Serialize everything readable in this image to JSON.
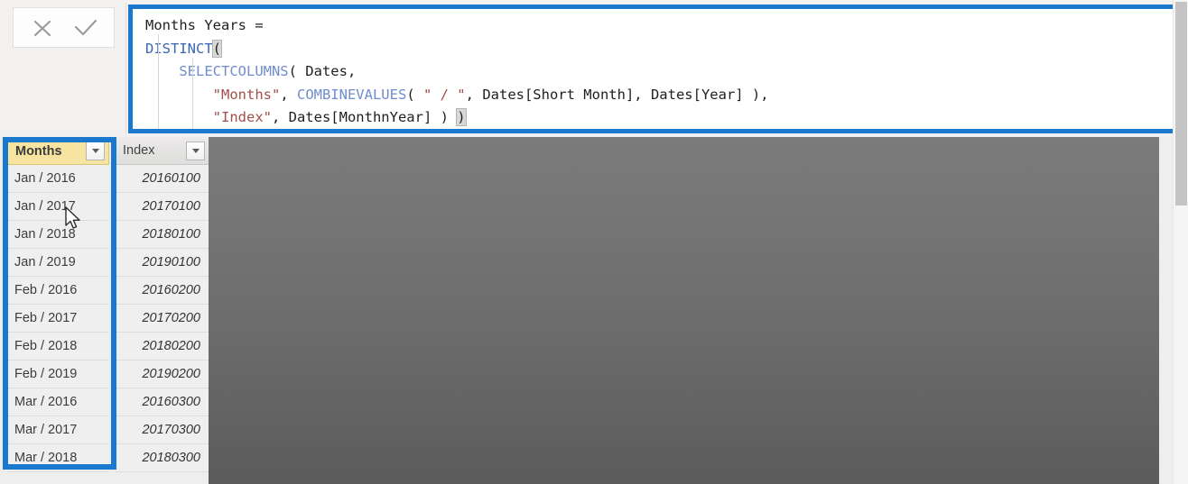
{
  "app": {
    "name": "power-bi-dax-formula-editor"
  },
  "formula_bar": {
    "cancel_label": "✕",
    "commit_label": "✓",
    "cancel_title": "Cancel",
    "commit_title": "Commit",
    "lines": [
      {
        "id": "l1",
        "indent": 0,
        "tokens": [
          {
            "type": "plain",
            "text": "Months Years ="
          }
        ]
      },
      {
        "id": "l2",
        "indent": 0,
        "tokens": [
          {
            "type": "kw",
            "text": "DISTINCT"
          },
          {
            "type": "paren-hl",
            "text": "("
          }
        ]
      },
      {
        "id": "l3",
        "indent": 1,
        "tokens": [
          {
            "type": "fn",
            "text": "    SELECTCOLUMNS"
          },
          {
            "type": "plain",
            "text": "( Dates,"
          }
        ]
      },
      {
        "id": "l4",
        "indent": 2,
        "tokens": [
          {
            "type": "str",
            "text": "        \"Months\""
          },
          {
            "type": "plain",
            "text": ", "
          },
          {
            "type": "fn",
            "text": "COMBINEVALUES"
          },
          {
            "type": "plain",
            "text": "( "
          },
          {
            "type": "str",
            "text": "\" / \""
          },
          {
            "type": "plain",
            "text": ", Dates[Short Month], Dates[Year] ),"
          }
        ]
      },
      {
        "id": "l5",
        "indent": 2,
        "tokens": [
          {
            "type": "str",
            "text": "        \"Index\""
          },
          {
            "type": "plain",
            "text": ", Dates[MonthnYear] ) "
          },
          {
            "type": "paren-hl",
            "text": ")"
          }
        ]
      }
    ],
    "full_text": "Months Years =\nDISTINCT(\n    SELECTCOLUMNS( Dates,\n        \"Months\", COMBINEVALUES( \" / \", Dates[Short Month], Dates[Year] ),\n        \"Index\", Dates[MonthnYear] ) )"
  },
  "table": {
    "columns": [
      {
        "key": "months",
        "label": "Months",
        "active": true,
        "filter_icon": "chevron-down-icon"
      },
      {
        "key": "index",
        "label": "Index",
        "active": false,
        "filter_icon": "chevron-down-icon"
      }
    ],
    "rows": [
      {
        "months": "Jan / 2016",
        "index": "20160100"
      },
      {
        "months": "Jan / 2017",
        "index": "20170100"
      },
      {
        "months": "Jan / 2018",
        "index": "20180100"
      },
      {
        "months": "Jan / 2019",
        "index": "20190100"
      },
      {
        "months": "Feb / 2016",
        "index": "20160200"
      },
      {
        "months": "Feb / 2017",
        "index": "20170200"
      },
      {
        "months": "Feb / 2018",
        "index": "20180200"
      },
      {
        "months": "Feb / 2019",
        "index": "20190200"
      },
      {
        "months": "Mar / 2016",
        "index": "20160300"
      },
      {
        "months": "Mar / 2017",
        "index": "20170300"
      },
      {
        "months": "Mar / 2018",
        "index": "20180300"
      }
    ]
  },
  "annotations": {
    "highlight_color": "#1a79cf",
    "active_header_color": "#f7e4a1",
    "formula_box_name": "formula-highlight-box",
    "table_box_name": "months-column-highlight-box"
  },
  "scrollbar": {
    "orientation": "vertical",
    "thumb_position": "top"
  }
}
